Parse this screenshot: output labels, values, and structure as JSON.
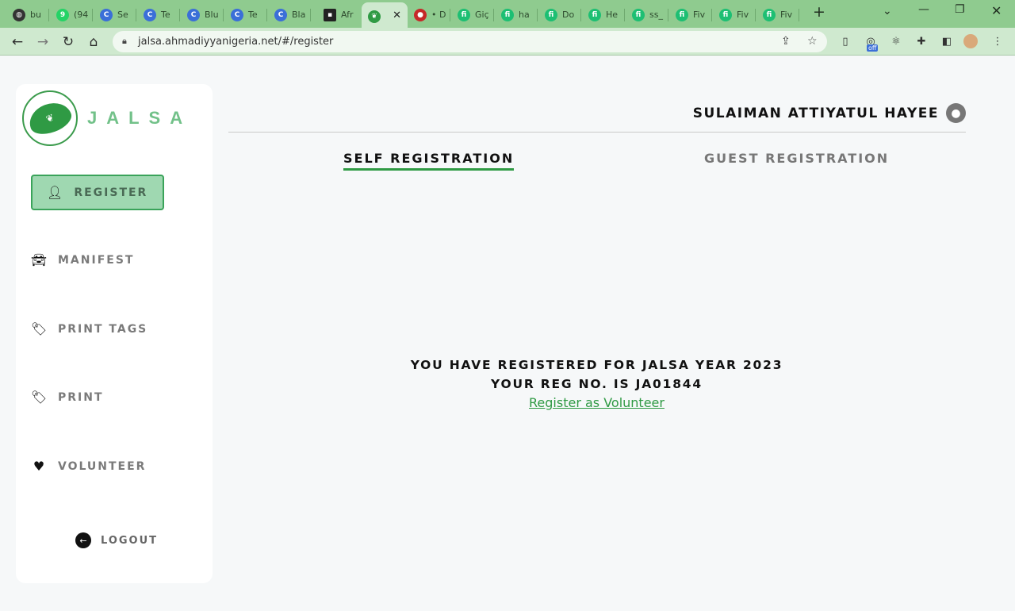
{
  "browser": {
    "tabs": [
      {
        "label": "bu",
        "icon": "globe-icon",
        "color": "#333333"
      },
      {
        "label": "(94",
        "icon": "whatsapp-icon",
        "color": "#25d366"
      },
      {
        "label": "Se",
        "icon": "c-icon",
        "color": "#3b6fd8"
      },
      {
        "label": "Te",
        "icon": "c-icon",
        "color": "#3b6fd8"
      },
      {
        "label": "Blu",
        "icon": "c-icon",
        "color": "#3b6fd8"
      },
      {
        "label": "Te",
        "icon": "c-icon",
        "color": "#3b6fd8"
      },
      {
        "label": "Bla",
        "icon": "c-icon",
        "color": "#3b6fd8"
      },
      {
        "label": "Afr",
        "icon": "image-icon",
        "color": "#222222"
      },
      {
        "label": "",
        "icon": "leaf-icon",
        "color": "#2f9a44",
        "active": true
      },
      {
        "label": "• D",
        "icon": "record-icon",
        "color": "#c62828"
      },
      {
        "label": "Giç",
        "icon": "fiverr-icon",
        "color": "#1dbf73"
      },
      {
        "label": "ha",
        "icon": "fiverr-icon",
        "color": "#1dbf73"
      },
      {
        "label": "Do",
        "icon": "fiverr-icon",
        "color": "#1dbf73"
      },
      {
        "label": "He",
        "icon": "fiverr-icon",
        "color": "#1dbf73"
      },
      {
        "label": "ss_",
        "icon": "fiverr-icon",
        "color": "#1dbf73"
      },
      {
        "label": "Fiv",
        "icon": "fiverr-icon",
        "color": "#1dbf73"
      },
      {
        "label": "Fiv",
        "icon": "fiverr-icon",
        "color": "#1dbf73"
      },
      {
        "label": "Fiv",
        "icon": "fiverr-icon",
        "color": "#1dbf73"
      }
    ],
    "url": "jalsa.ahmadiyyanigeria.net/#/register",
    "extension_badge": "off"
  },
  "sidebar": {
    "brand": "JALSA",
    "register_label": "REGISTER",
    "items": [
      {
        "label": "MANIFEST",
        "icon": "car-icon"
      },
      {
        "label": "PRINT TAGS",
        "icon": "tags-icon"
      },
      {
        "label": "PRINT",
        "icon": "tags-icon"
      },
      {
        "label": "VOLUNTEER",
        "icon": "hand-holding-heart-icon"
      }
    ],
    "logout_label": "LOGOUT"
  },
  "header": {
    "user_name": "SULAIMAN ATTIYATUL HAYEE"
  },
  "tabs": {
    "self": "SELF REGISTRATION",
    "guest": "GUEST REGISTRATION"
  },
  "message": {
    "line1": "YOU HAVE REGISTERED FOR JALSA YEAR 2023",
    "line2": "YOUR REG NO. IS JA01844",
    "link": "Register as Volunteer"
  },
  "colors": {
    "accent": "#2f9a44",
    "chrome_frame": "#8fcb8f",
    "register_bg": "#9fd8b1"
  }
}
